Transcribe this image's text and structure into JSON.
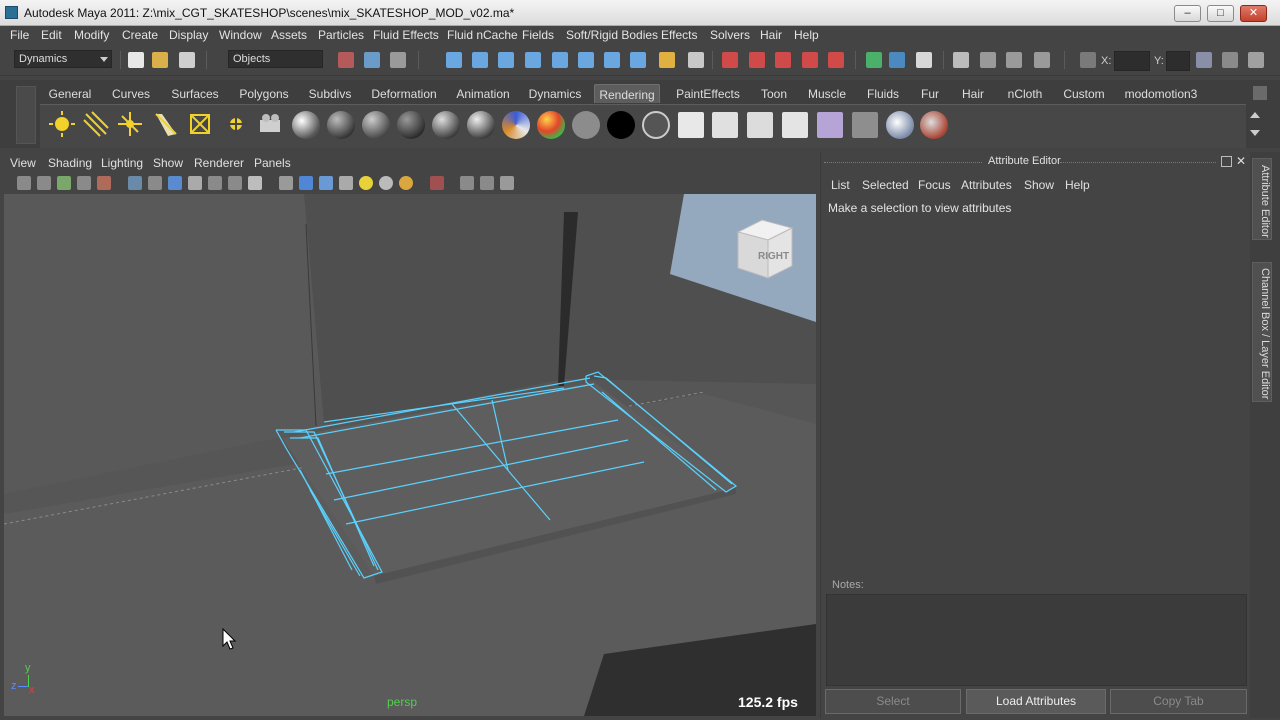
{
  "window": {
    "title": "Autodesk Maya 2011: Z:\\mix_CGT_SKATESHOP\\scenes\\mix_SKATESHOP_MOD_v02.ma*",
    "minimize": "–",
    "maximize": "□",
    "close": "✕"
  },
  "menubar": [
    "File",
    "Edit",
    "Modify",
    "Create",
    "Display",
    "Window",
    "Assets",
    "Particles",
    "Fluid Effects",
    "Fluid nCache",
    "Fields",
    "Soft/Rigid Bodies",
    "Effects",
    "Solvers",
    "Hair",
    "Help"
  ],
  "statusline": {
    "menuset": "Dynamics",
    "selection_mode": "Objects",
    "x_label": "X:",
    "y_label": "Y:"
  },
  "shelf": {
    "tabs": [
      "General",
      "Curves",
      "Surfaces",
      "Polygons",
      "Subdivs",
      "Deformation",
      "Animation",
      "Dynamics",
      "Rendering",
      "PaintEffects",
      "Toon",
      "Muscle",
      "Fluids",
      "Fur",
      "Hair",
      "nCloth",
      "Custom",
      "modomotion3"
    ],
    "active_tab": "Rendering"
  },
  "panel": {
    "menus": [
      "View",
      "Shading",
      "Lighting",
      "Show",
      "Renderer",
      "Panels"
    ],
    "camera": "persp",
    "fps": "125.2 fps",
    "viewcube_face": "RIGHT",
    "axis": {
      "x": "x",
      "y": "y",
      "z": "z"
    }
  },
  "attribute_editor": {
    "title": "Attribute Editor",
    "menus": [
      "List",
      "Selected",
      "Focus",
      "Attributes",
      "Show",
      "Help"
    ],
    "message": "Make a selection to view attributes",
    "notes_label": "Notes:",
    "buttons": {
      "select": "Select",
      "load": "Load Attributes",
      "copy": "Copy Tab"
    }
  },
  "side_tabs": [
    "Attribute Editor",
    "Channel Box / Layer Editor"
  ],
  "colors": {
    "wireframe": "#5ad2ff",
    "persp_label": "#4fcf4f",
    "active_tab": "#5d5d5d"
  }
}
